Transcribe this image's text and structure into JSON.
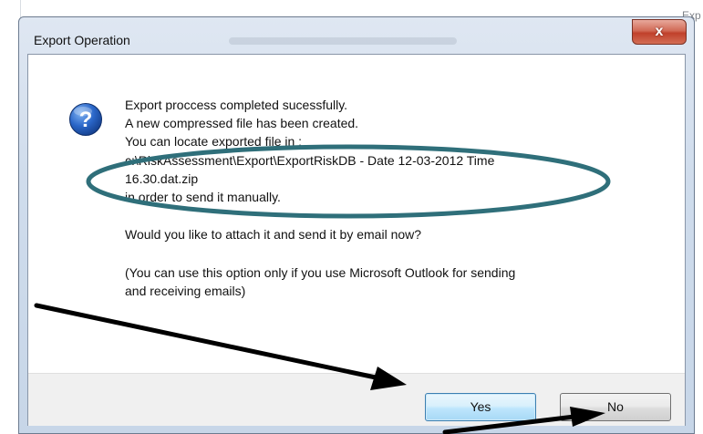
{
  "background": {
    "corner_label": "Exp"
  },
  "dialog": {
    "title": "Export Operation",
    "close_glyph": "x",
    "icon": "question-icon",
    "lines": [
      "Export proccess completed sucessfully.",
      "A new compressed file has been created.",
      "You can locate exported file in :",
      "c:\\RiskAssessment\\Export\\ExportRiskDB - Date 12-03-2012 Time",
      "16.30.dat.zip",
      "in order to send it manually.",
      "Would you like to attach it and send it by email now?",
      "(You can use this option only if you use Microsoft Outlook for sending",
      "and receiving emails)"
    ],
    "buttons": {
      "yes": "Yes",
      "no": "No"
    }
  },
  "annotations": {
    "ellipse_color": "#2f6f7a",
    "arrow_color": "#000000"
  }
}
